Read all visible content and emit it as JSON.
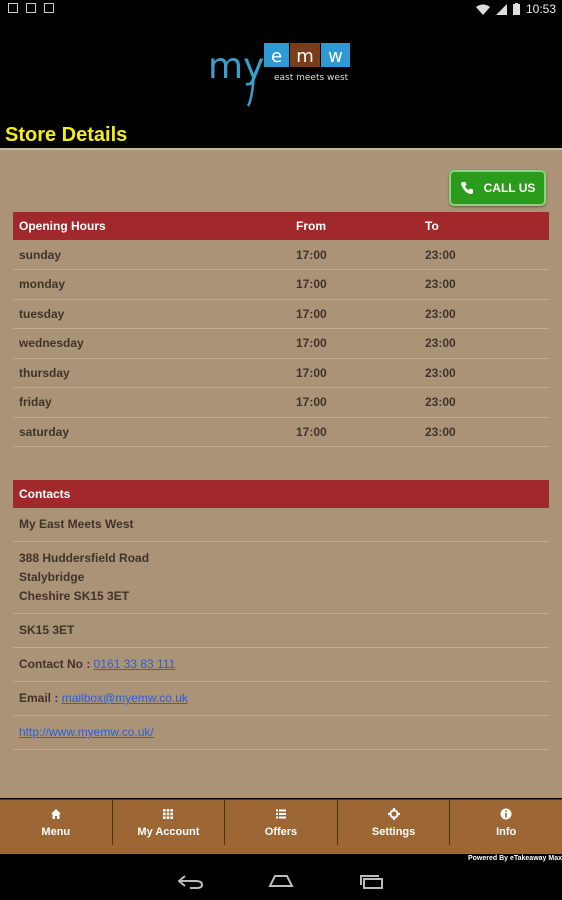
{
  "status_bar": {
    "time": "10:53"
  },
  "logo": {
    "my": "my",
    "letters": [
      "e",
      "m",
      "w"
    ],
    "tagline": "east meets west"
  },
  "page_title": "Store Details",
  "call_button": {
    "label": "CALL US"
  },
  "hours_table": {
    "headers": [
      "Opening Hours",
      "From",
      "To"
    ],
    "rows": [
      {
        "day": "sunday",
        "from": "17:00",
        "to": "23:00"
      },
      {
        "day": "monday",
        "from": "17:00",
        "to": "23:00"
      },
      {
        "day": "tuesday",
        "from": "17:00",
        "to": "23:00"
      },
      {
        "day": "wednesday",
        "from": "17:00",
        "to": "23:00"
      },
      {
        "day": "thursday",
        "from": "17:00",
        "to": "23:00"
      },
      {
        "day": "friday",
        "from": "17:00",
        "to": "23:00"
      },
      {
        "day": "saturday",
        "from": "17:00",
        "to": "23:00"
      }
    ]
  },
  "contacts": {
    "header": "Contacts",
    "name": "My East Meets West",
    "address_lines": [
      "388 Huddersfield Road",
      "Stalybridge",
      "Cheshire SK15 3ET"
    ],
    "postcode": "SK15 3ET",
    "contact_label": "Contact No :",
    "phone": "0161 33 83 111",
    "email_label": "Email :",
    "email": "mailbox@myemw.co.uk",
    "website": "http://www.myemw.co.uk/"
  },
  "tabs": [
    {
      "label": "Menu",
      "icon": "home-icon"
    },
    {
      "label": "My Account",
      "icon": "grid-icon"
    },
    {
      "label": "Offers",
      "icon": "list-icon"
    },
    {
      "label": "Settings",
      "icon": "gear-icon"
    },
    {
      "label": "Info",
      "icon": "info-icon"
    }
  ],
  "footer": {
    "powered": "Powered By eTakeaway Max"
  },
  "colors": {
    "background": "#ab9378",
    "header_red": "#a1282b",
    "title_yellow": "#f5ec1a",
    "call_green": "#2b9b1c",
    "tab_brown": "#9c6735",
    "link_blue": "#2760e0"
  }
}
